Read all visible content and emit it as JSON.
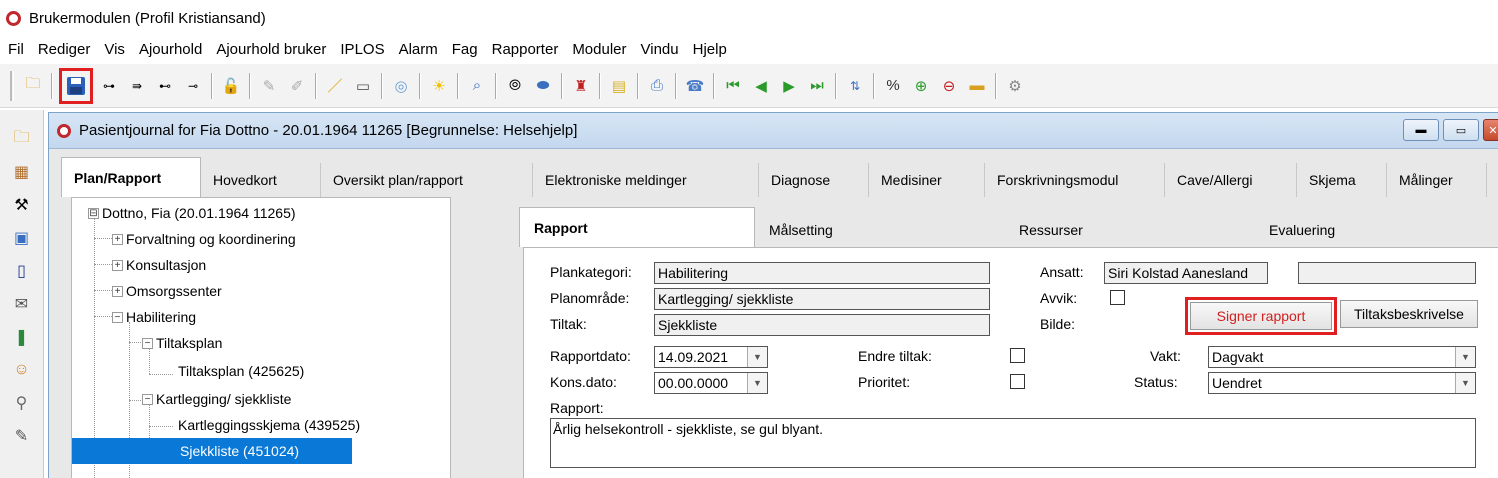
{
  "app": {
    "title": "Brukermodulen (Profil Kristiansand)"
  },
  "menu": [
    "Fil",
    "Rediger",
    "Vis",
    "Ajourhold",
    "Ajourhold bruker",
    "IPLOS",
    "Alarm",
    "Fag",
    "Rapporter",
    "Moduler",
    "Vindu",
    "Hjelp"
  ],
  "toolbar": {
    "icons": [
      "open-folder-icon",
      "save-icon",
      "tree-expand-icon",
      "tree-collapse-icon",
      "outline-icon",
      "outline-alt-icon",
      "unlock-icon",
      "sign-icon",
      "sign-all-icon",
      "pencil-icon",
      "card-icon",
      "cd-icon",
      "lightbulb-icon",
      "search-icon",
      "binoculars-icon",
      "eraser-icon",
      "stamp-icon",
      "notes-icon",
      "print-icon",
      "fax-icon",
      "first-icon",
      "prev-icon",
      "next-icon",
      "last-icon",
      "sort-icon",
      "percent-icon",
      "zoom-in-icon",
      "zoom-out-icon",
      "ruler-icon",
      "tools-icon"
    ]
  },
  "child": {
    "title": "Pasientjournal for Fia Dottno - 20.01.1964 11265  [Begrunnelse: Helsehjelp]"
  },
  "tabs": [
    "Plan/Rapport",
    "Hovedkort",
    "Oversikt plan/rapport",
    "Elektroniske meldinger",
    "Diagnose",
    "Medisiner",
    "Forskrivningsmodul",
    "Cave/Allergi",
    "Skjema",
    "Målinger"
  ],
  "tree": {
    "items": [
      {
        "label": "Dottno, Fia (20.01.1964 11265)",
        "exp": "⊟"
      },
      {
        "label": "Forvaltning og koordinering",
        "exp": "+"
      },
      {
        "label": "Konsultasjon",
        "exp": "+"
      },
      {
        "label": "Omsorgssenter",
        "exp": "+"
      },
      {
        "label": "Habilitering",
        "exp": "−"
      },
      {
        "label": "Tiltaksplan",
        "exp": "−"
      },
      {
        "label": "Tiltaksplan (425625)",
        "exp": ""
      },
      {
        "label": "Kartlegging/ sjekkliste",
        "exp": "−"
      },
      {
        "label": "Kartleggingsskjema (439525)",
        "exp": ""
      },
      {
        "label": "Sjekkliste (451024)",
        "exp": ""
      }
    ]
  },
  "subtabs": [
    "Rapport",
    "Målsetting",
    "Ressurser",
    "Evaluering"
  ],
  "form": {
    "plankategori_label": "Plankategori:",
    "plankategori": "Habilitering",
    "planomrade_label": "Planområde:",
    "planomrade": "Kartlegging/ sjekkliste",
    "tiltak_label": "Tiltak:",
    "tiltak": "Sjekkliste",
    "ansatt_label": "Ansatt:",
    "ansatt": "Siri Kolstad Aanesland",
    "ansatt2": "",
    "avvik_label": "Avvik:",
    "bilde_label": "Bilde:",
    "signer_button": "Signer rapport",
    "tiltaksbeskrivelse_button": "Tiltaksbeskrivelse",
    "rapportdato_label": "Rapportdato:",
    "rapportdato": "14.09.2021",
    "konsdato_label": "Kons.dato:",
    "konsdato": "00.00.0000",
    "endre_label": "Endre tiltak:",
    "prioritet_label": "Prioritet:",
    "vakt_label": "Vakt:",
    "vakt": "Dagvakt",
    "status_label": "Status:",
    "status": "Uendret",
    "rapport_label": "Rapport:",
    "rapport_text": "Årlig helsekontroll - sjekkliste, se gul blyant."
  }
}
